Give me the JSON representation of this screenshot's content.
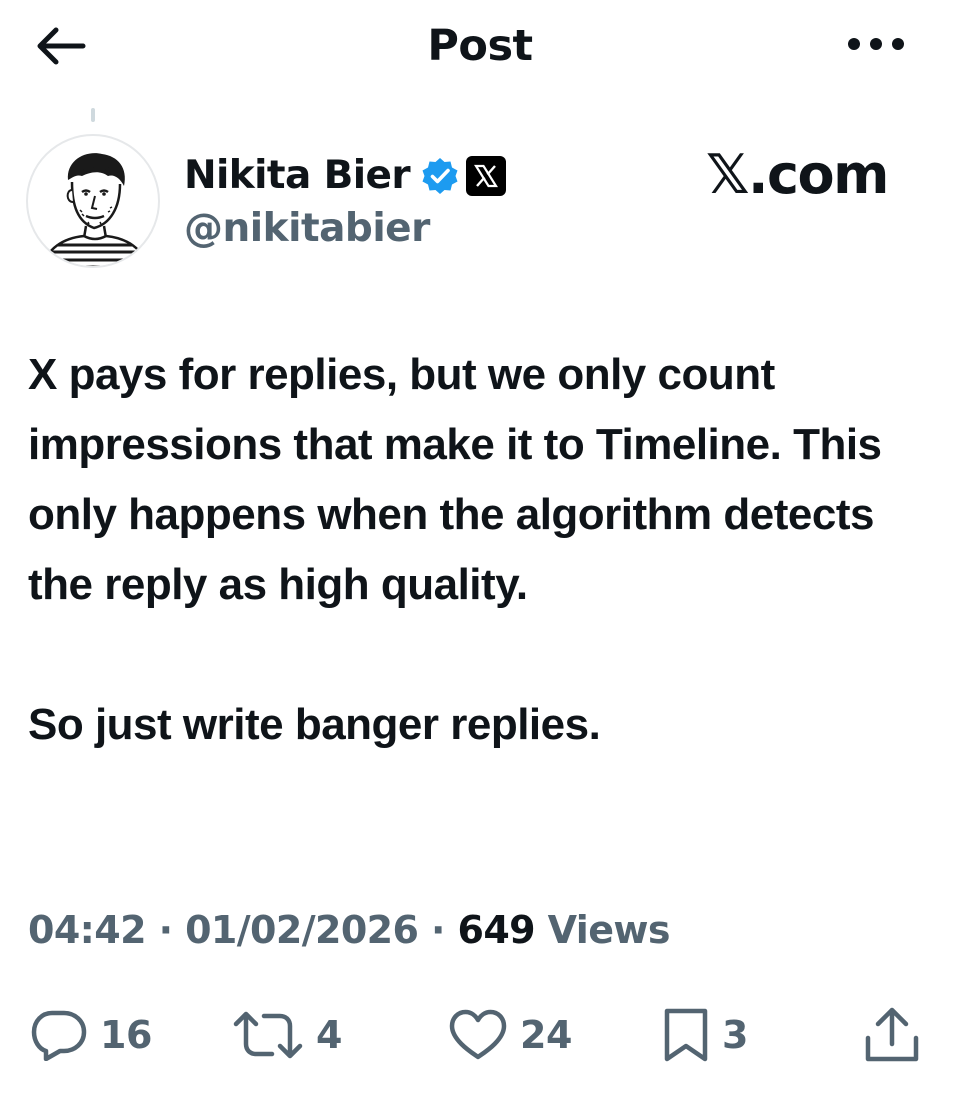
{
  "header": {
    "title": "Post",
    "back_icon": "arrow-left-icon",
    "more_icon": "more-dots-icon"
  },
  "author": {
    "display_name": "Nikita Bier",
    "handle": "@nikitabier",
    "verified_color": "#1d9bf0",
    "affiliate_badge": "x-logo-icon"
  },
  "watermark": "𝕏.com",
  "post": {
    "text": "X pays for replies, but we only count impressions that make it to Timeline. This only happens when the algorithm detects the reply as high quality.\n\nSo just write banger replies."
  },
  "meta": {
    "time": "04:42",
    "separator": " · ",
    "date": "01/02/2026",
    "views_count": "649",
    "views_label": " Views"
  },
  "actions": {
    "replies": "16",
    "reposts": "4",
    "likes": "24",
    "bookmarks": "3"
  },
  "colors": {
    "text_primary": "#0f1419",
    "text_secondary": "#536471"
  }
}
